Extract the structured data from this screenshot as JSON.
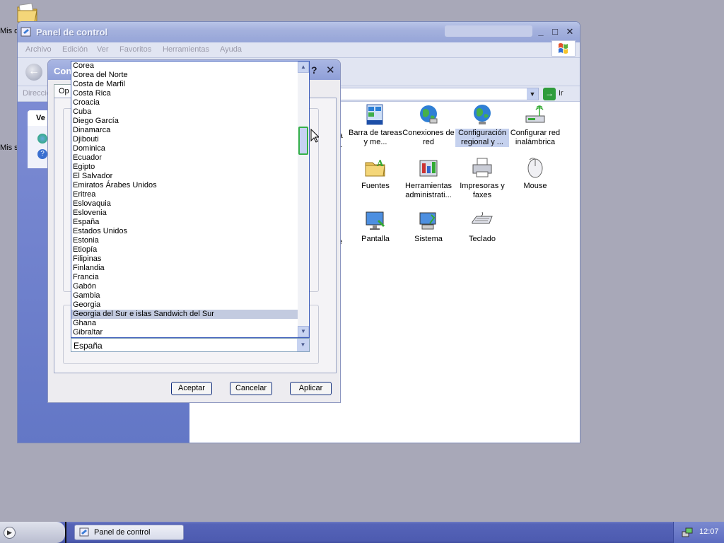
{
  "desktop": {
    "icon_labels": [
      "Mis d",
      "Mis s"
    ]
  },
  "window": {
    "title": "Panel de control",
    "menu": [
      "Archivo",
      "Edición",
      "Ver",
      "Favoritos",
      "Herramientas",
      "Ayuda"
    ],
    "address_label": "Direcció",
    "go_label": "Ir",
    "left_panel_title": "Ve"
  },
  "control_panel_icons": [
    {
      "label": "Barra de tareas y me...",
      "icon": "taskbar-icon"
    },
    {
      "label": "Conexiones de red",
      "icon": "network-globe-icon"
    },
    {
      "label": "Configuración regional y ...",
      "icon": "regional-globe-icon",
      "selected": true
    },
    {
      "label": "Configurar red inalámbrica",
      "icon": "wireless-icon"
    },
    {
      "label": "Fuentes",
      "icon": "fonts-folder-icon"
    },
    {
      "label": "Herramientas administrati...",
      "icon": "admin-tools-icon"
    },
    {
      "label": "Impresoras y faxes",
      "icon": "printer-icon"
    },
    {
      "label": "Mouse",
      "icon": "mouse-icon"
    },
    {
      "label": "Pantalla",
      "icon": "display-icon"
    },
    {
      "label": "Sistema",
      "icon": "system-icon"
    },
    {
      "label": "Teclado",
      "icon": "keyboard-icon"
    }
  ],
  "partial_labels": [
    "ra",
    "..."
  ],
  "partial_label_e": "e",
  "dialog": {
    "title": "Con",
    "tab_label": "Op",
    "help": "?",
    "close": "✕",
    "buttons": {
      "ok": "Aceptar",
      "cancel": "Cancelar",
      "apply": "Aplicar"
    }
  },
  "country_dropdown": {
    "items": [
      "Corea",
      "Corea del Norte",
      "Costa de Marfil",
      "Costa Rica",
      "Croacia",
      "Cuba",
      "Diego García",
      "Dinamarca",
      "Djibouti",
      "Dominica",
      "Ecuador",
      "Egipto",
      "El Salvador",
      "Emiratos Árabes Unidos",
      "Eritrea",
      "Eslovaquia",
      "Eslovenia",
      "España",
      "Estados Unidos",
      "Estonia",
      "Etiopía",
      "Filipinas",
      "Finlandia",
      "Francia",
      "Gabón",
      "Gambia",
      "Georgia",
      "Georgia del Sur e islas Sandwich del Sur",
      "Ghana",
      "Gibraltar"
    ],
    "highlighted_index": 27,
    "selected_value": "España"
  },
  "taskbar": {
    "task_label": "Panel de control",
    "clock": "12:07"
  },
  "colors": {
    "desktop": "#a8a8b8",
    "highlight": "#c3cbe0",
    "scroll_thumb_border": "#34b04a"
  }
}
